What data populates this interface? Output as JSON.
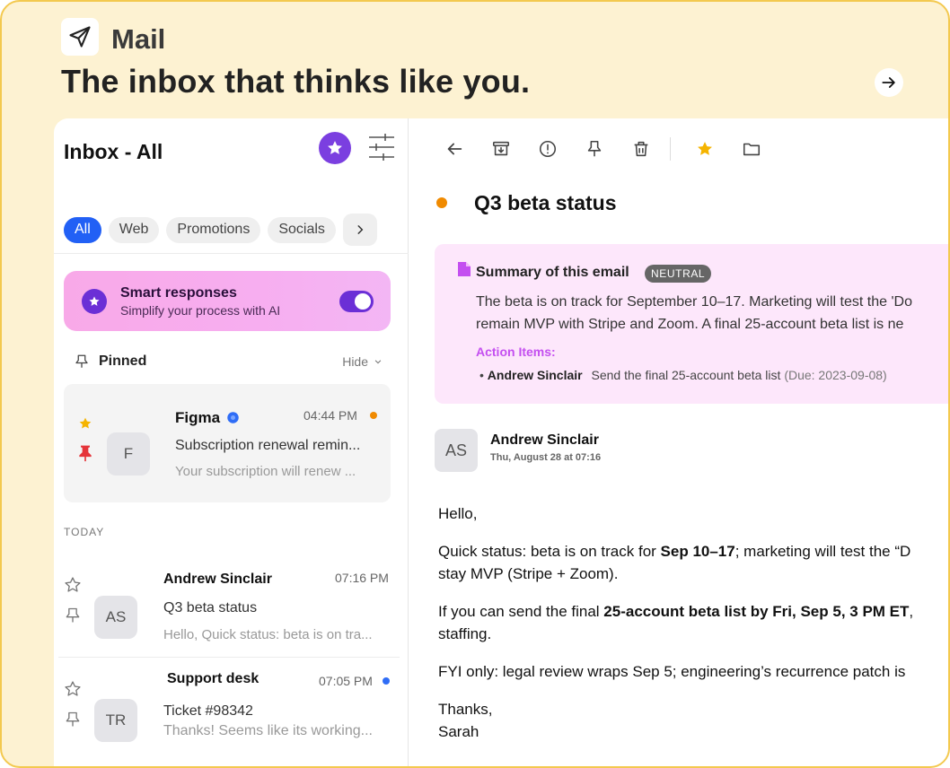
{
  "header": {
    "app_name": "Mail",
    "tagline": "The inbox that thinks like you."
  },
  "sidebar": {
    "title": "Inbox - All",
    "filters": [
      "All",
      "Web",
      "Promotions",
      "Socials"
    ],
    "smart": {
      "title": "Smart responses",
      "subtitle": "Simplify your process with AI",
      "enabled": true
    },
    "pinned_label": "Pinned",
    "hide_label": "Hide",
    "pinned_email": {
      "sender": "Figma",
      "avatar": "F",
      "time": "04:44 PM",
      "subject": "Subscription renewal remin...",
      "preview": "Your subscription will renew ..."
    },
    "section_label": "TODAY",
    "emails": [
      {
        "sender": "Andrew Sinclair",
        "avatar": "AS",
        "time": "07:16 PM",
        "subject": "Q3 beta status",
        "preview": "Hello, Quick status: beta is on tra..."
      },
      {
        "sender": "Support desk",
        "avatar": "TR",
        "time": "07:05 PM",
        "subject": "Ticket #98342",
        "preview": "Thanks! Seems like its working..."
      }
    ]
  },
  "message": {
    "subject": "Q3 beta status",
    "summary": {
      "title": "Summary of this email",
      "badge": "NEUTRAL",
      "line1": "The beta is on track for September 10–17. Marketing will test the 'Do",
      "line2": "remain MVP with Stripe and Zoom. A final 25-account beta list is ne",
      "action_title": "Action Items:",
      "action_name": "Andrew Sinclair",
      "action_text": "Send the final 25-account beta list",
      "action_due": "(Due: 2023-09-08)"
    },
    "from": "Andrew Sinclair",
    "avatar": "AS",
    "date": "Thu, August 28 at 07:16",
    "body": {
      "greeting": "Hello,",
      "p1_a": "Quick status: beta is on track for ",
      "p1_b": "Sep 10–17",
      "p1_c": "; marketing will test the “D",
      "p1_line2": "stay MVP (Stripe + Zoom).",
      "p2_a": "If you can send the final ",
      "p2_b": "25-account beta list by Fri, Sep 5, 3 PM ET",
      "p2_c": ",",
      "p2_line2": "staffing.",
      "p3": "FYI only: legal review wraps Sep 5; engineering’s recurrence patch is",
      "closing": "Thanks,",
      "signature": "Sarah"
    }
  },
  "colors": {
    "accent_blue": "#2260f5",
    "accent_purple": "#6b2fd6",
    "unread_orange": "#f08a00",
    "star_yellow": "#f5b400",
    "pin_red": "#e5343a"
  }
}
